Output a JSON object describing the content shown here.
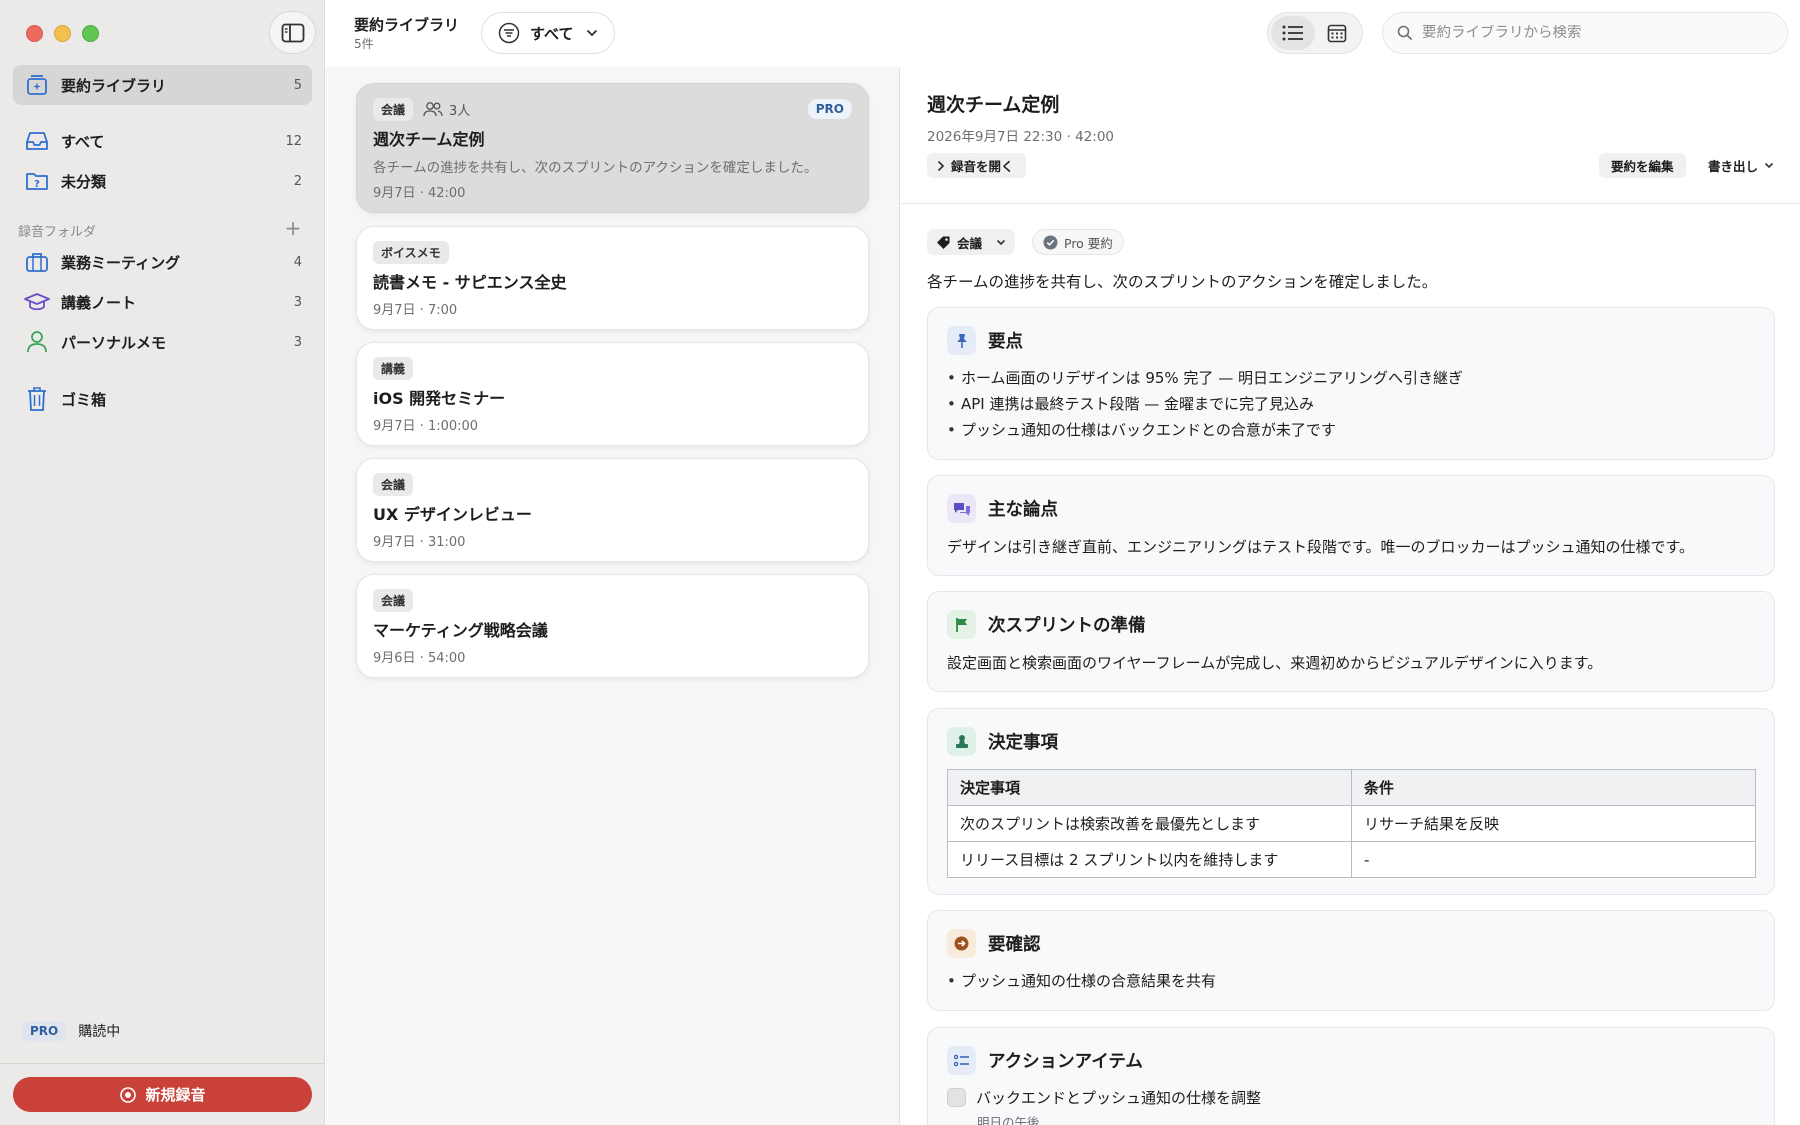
{
  "colors": {
    "accent_red": "#c94139",
    "pro_blue": "#2f5e9e"
  },
  "sidebar": {
    "items_top": [
      {
        "label": "要約ライブラリ",
        "count": "5",
        "icon": "library-sparkle-icon"
      }
    ],
    "items_main": [
      {
        "label": "すべて",
        "count": "12",
        "icon": "tray-icon"
      },
      {
        "label": "未分類",
        "count": "2",
        "icon": "question-folder-icon"
      }
    ],
    "section_label": "録音フォルダ",
    "folders": [
      {
        "label": "業務ミーティング",
        "count": "4",
        "icon": "briefcase-icon"
      },
      {
        "label": "講義ノート",
        "count": "3",
        "icon": "graduation-cap-icon"
      },
      {
        "label": "パーソナルメモ",
        "count": "3",
        "icon": "person-icon"
      }
    ],
    "trash_label": "ゴミ箱",
    "pro_badge": "PRO",
    "pro_status": "購読中",
    "new_recording": "新規録音"
  },
  "list": {
    "title": "要約ライブラリ",
    "count": "5件",
    "filter_label": "すべて",
    "cards": [
      {
        "tag": "会議",
        "people": "3人",
        "badge": "PRO",
        "title": "週次チーム定例",
        "summary": "各チームの進捗を共有し、次のスプリントのアクションを確定しました。",
        "meta": "9月7日 · 42:00"
      },
      {
        "tag": "ボイスメモ",
        "title": "読書メモ - サピエンス全史",
        "meta": "9月7日 · 7:00"
      },
      {
        "tag": "講義",
        "title": "iOS 開発セミナー",
        "meta": "9月7日 · 1:00:00"
      },
      {
        "tag": "会議",
        "title": "UX デザインレビュー",
        "meta": "9月7日 · 31:00"
      },
      {
        "tag": "会議",
        "title": "マーケティング戦略会議",
        "meta": "9月6日 · 54:00"
      }
    ]
  },
  "detail": {
    "search_placeholder": "要約ライブラリから検索",
    "title": "週次チーム定例",
    "meta": "2026年9月7日 22:30 · 42:00",
    "open_recording": "録音を開く",
    "edit_summary": "要約を編集",
    "export": "書き出し",
    "category": "会議",
    "pro_summary": "Pro 要約",
    "summary": "各チームの進捗を共有し、次のスプリントのアクションを確定しました。",
    "key_points": {
      "heading": "要点",
      "items": [
        "ホーム画面のリデザインは 95% 完了 — 明日エンジニアリングへ引き継ぎ",
        "API 連携は最終テスト段階 — 金曜までに完了見込み",
        "プッシュ通知の仕様はバックエンドとの合意が未了です"
      ]
    },
    "main_topics": {
      "heading": "主な論点",
      "text": "デザインは引き継ぎ直前、エンジニアリングはテスト段階です。唯一のブロッカーはプッシュ通知の仕様です。"
    },
    "next_sprint": {
      "heading": "次スプリントの準備",
      "text": "設定画面と検索画面のワイヤーフレームが完成し、来週初めからビジュアルデザインに入ります。"
    },
    "decisions": {
      "heading": "決定事項",
      "columns": [
        "決定事項",
        "条件"
      ],
      "rows": [
        [
          "次のスプリントは検索改善を最優先とします",
          "リサーチ結果を反映"
        ],
        [
          "リリース目標は 2 スプリント以内を維持します",
          "-"
        ]
      ]
    },
    "to_confirm": {
      "heading": "要確認",
      "items": [
        "プッシュ通知の仕様の合意結果を共有"
      ]
    },
    "action_items": {
      "heading": "アクションアイテム",
      "items": [
        {
          "text": "バックエンドとプッシュ通知の仕様を調整",
          "due": "明日の午後"
        }
      ]
    }
  }
}
